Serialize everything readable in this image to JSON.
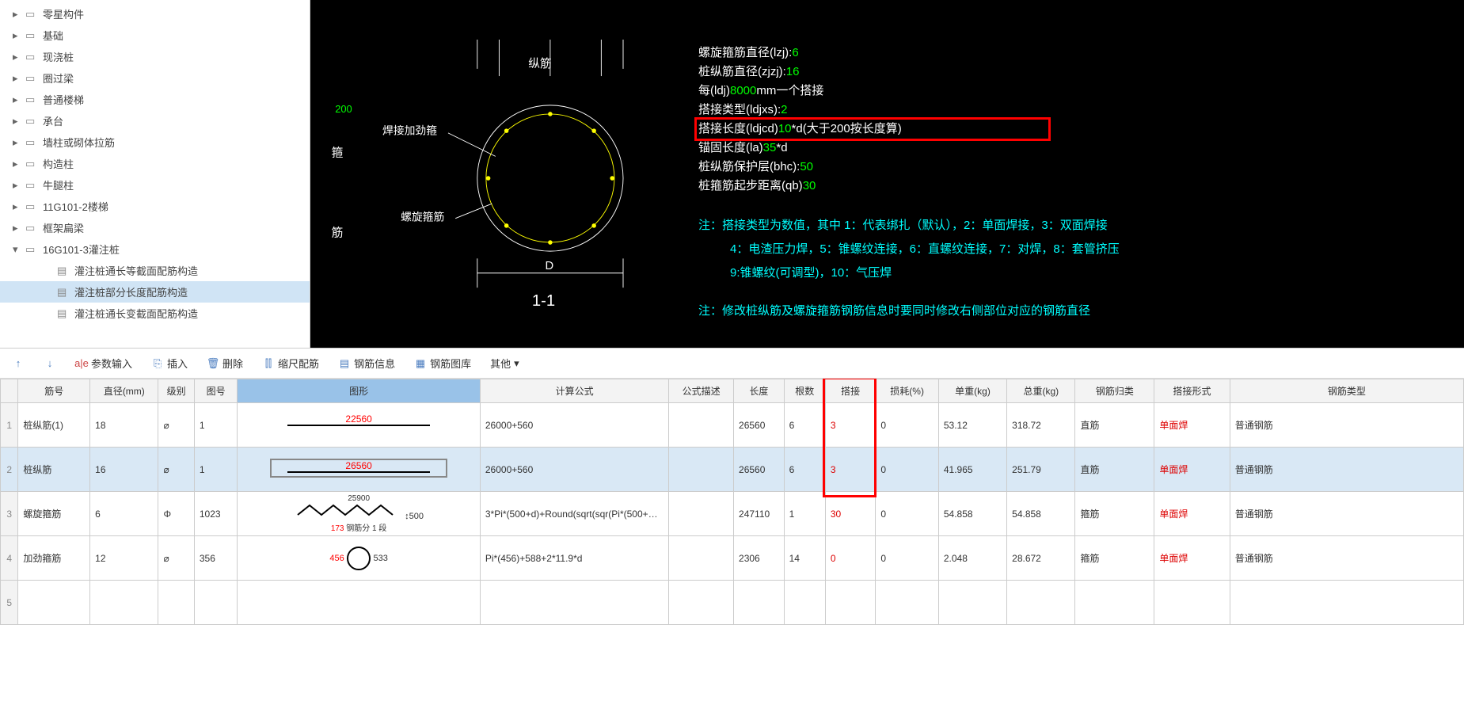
{
  "tree": [
    {
      "label": "零星构件",
      "icon": "folder",
      "arrow": "▸"
    },
    {
      "label": "基础",
      "icon": "folder",
      "arrow": "▸"
    },
    {
      "label": "现浇桩",
      "icon": "folder",
      "arrow": "▸"
    },
    {
      "label": "圈过梁",
      "icon": "folder",
      "arrow": "▸"
    },
    {
      "label": "普通楼梯",
      "icon": "folder",
      "arrow": "▸"
    },
    {
      "label": "承台",
      "icon": "folder",
      "arrow": "▸"
    },
    {
      "label": "墙柱或砌体拉筋",
      "icon": "folder",
      "arrow": "▸"
    },
    {
      "label": "构造柱",
      "icon": "folder",
      "arrow": "▸"
    },
    {
      "label": "牛腿柱",
      "icon": "folder",
      "arrow": "▸"
    },
    {
      "label": "11G101-2楼梯",
      "icon": "folder",
      "arrow": "▸"
    },
    {
      "label": "框架扁梁",
      "icon": "folder",
      "arrow": "▸"
    },
    {
      "label": "16G101-3灌注桩",
      "icon": "folder",
      "arrow": "▾",
      "expanded": true
    },
    {
      "label": "灌注桩通长等截面配筋构造",
      "icon": "doc",
      "child": true
    },
    {
      "label": "灌注桩部分长度配筋构造",
      "icon": "doc",
      "child": true,
      "selected": true
    },
    {
      "label": "灌注桩通长变截面配筋构造",
      "icon": "doc",
      "child": true
    }
  ],
  "cad": {
    "labels": {
      "zongjin": "纵筋",
      "hanjie": "焊接加劲箍",
      "luoxuan": "螺旋箍筋",
      "d": "D",
      "section": "1-1",
      "dim200": "200"
    },
    "params": [
      {
        "k": "螺旋箍筋直径(lzj):",
        "v": "6"
      },
      {
        "k": "桩纵筋直径(zjzj):",
        "v": "16"
      },
      {
        "k": "每(ldj)",
        "v": "8000",
        "suffix": "mm一个搭接"
      },
      {
        "k": "搭接类型(ldjxs):",
        "v": "2"
      },
      {
        "k": "搭接长度(ldjcd)",
        "v": "10",
        "suffix": "*d(大于200按长度算)",
        "boxed": true
      },
      {
        "k": "锚固长度(la)",
        "v": "35",
        "suffix": "*d"
      },
      {
        "k": "桩纵筋保护层(bhc):",
        "v": "50"
      },
      {
        "k": "桩箍筋起步距离(qb)",
        "v": "30"
      }
    ],
    "note1": "注：搭接类型为数值，其中 1：代表绑扎（默认），2：单面焊接，3：双面焊接",
    "note2": "4：电渣压力焊，5：锥螺纹连接，6：直螺纹连接，7：对焊，8：套管挤压",
    "note3": "9:锥螺纹(可调型)，10：气压焊",
    "note4": "注：修改桩纵筋及螺旋箍筋钢筋信息时要同时修改右侧部位对应的钢筋直径"
  },
  "toolbar": {
    "param": "参数输入",
    "insert": "插入",
    "delete": "删除",
    "scale": "缩尺配筋",
    "info": "钢筋信息",
    "lib": "钢筋图库",
    "other": "其他"
  },
  "columns": [
    "",
    "筋号",
    "直径(mm)",
    "级别",
    "图号",
    "图形",
    "计算公式",
    "公式描述",
    "长度",
    "根数",
    "搭接",
    "损耗(%)",
    "单重(kg)",
    "总重(kg)",
    "钢筋归类",
    "搭接形式",
    "钢筋类型"
  ],
  "rows": [
    {
      "n": "1",
      "name": "桩纵筋(1)",
      "dia": "18",
      "lvl": "⌀",
      "fig": "1",
      "shape": "22560",
      "formula": "26000+560",
      "desc": "",
      "len": "26560",
      "cnt": "6",
      "splice": "3",
      "loss": "0",
      "uw": "53.12",
      "tw": "318.72",
      "cat": "直筋",
      "form": "单面焊",
      "type": "普通钢筋"
    },
    {
      "n": "2",
      "name": "桩纵筋",
      "dia": "16",
      "lvl": "⌀",
      "fig": "1",
      "shape": "26560",
      "formula": "26000+560",
      "desc": "",
      "len": "26560",
      "cnt": "6",
      "splice": "3",
      "loss": "0",
      "uw": "41.965",
      "tw": "251.79",
      "cat": "直筋",
      "form": "单面焊",
      "type": "普通钢筋",
      "sel": true,
      "boxed": true
    },
    {
      "n": "3",
      "name": "螺旋箍筋",
      "dia": "6",
      "lvl": "Φ",
      "fig": "1023",
      "shape_zig": true,
      "shape_top": "25900",
      "shape_l": "173",
      "shape_r": "500",
      "shape_sub": "钢筋分 1 段",
      "formula": "3*Pi*(500+d)+Round(sqrt(sqr(Pi*(500+…",
      "desc": "",
      "len": "247110",
      "cnt": "1",
      "splice": "30",
      "loss": "0",
      "uw": "54.858",
      "tw": "54.858",
      "cat": "箍筋",
      "form": "单面焊",
      "type": "普通钢筋"
    },
    {
      "n": "4",
      "name": "加劲箍筋",
      "dia": "12",
      "lvl": "⌀",
      "fig": "356",
      "shape_circle": true,
      "shape_l": "456",
      "shape_r": "533",
      "formula": "Pi*(456)+588+2*11.9*d",
      "desc": "",
      "len": "2306",
      "cnt": "14",
      "splice": "0",
      "loss": "0",
      "uw": "2.048",
      "tw": "28.672",
      "cat": "箍筋",
      "form": "单面焊",
      "type": "普通钢筋"
    },
    {
      "n": "5"
    }
  ]
}
